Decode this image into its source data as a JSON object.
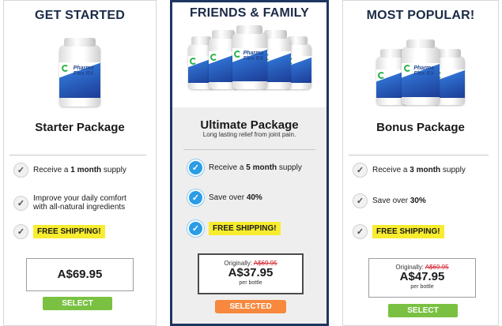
{
  "packages": [
    {
      "ribbon": "GET STARTED",
      "name": "Starter Package",
      "subtitle": "",
      "features": [
        {
          "pre": "Receive a ",
          "bold": "1 month",
          "post": " supply"
        },
        {
          "line1": "Improve your daily comfort",
          "line2": "with all-natural ingredients"
        }
      ],
      "shipping": "FREE SHIPPING!",
      "original_label": "",
      "original_price": "",
      "price": "A$69.95",
      "per_unit": "",
      "button": "SELECT"
    },
    {
      "ribbon": "FRIENDS & FAMILY",
      "name": "Ultimate Package",
      "subtitle": "Long lasting relief from joint pain.",
      "features": [
        {
          "pre": "Receive a ",
          "bold": "5 month",
          "post": " supply"
        },
        {
          "pre": "Save over ",
          "bold": "40%",
          "post": ""
        }
      ],
      "shipping": "FREE SHIPPING!",
      "original_label": "Originally: ",
      "original_price": "A$69.95",
      "price": "A$37.95",
      "per_unit": "per bottle",
      "button": "SELECTED"
    },
    {
      "ribbon": "MOST POPULAR!",
      "name": "Bonus Package",
      "subtitle": "",
      "features": [
        {
          "pre": "Receive a ",
          "bold": "3 month",
          "post": " supply"
        },
        {
          "pre": "Save over ",
          "bold": "30%",
          "post": ""
        }
      ],
      "shipping": "FREE SHIPPING!",
      "original_label": "Originally: ",
      "original_price": "A$69.95",
      "price": "A$47.95",
      "per_unit": "per bottle",
      "button": "SELECT"
    }
  ],
  "product_label": "Pharma Flex RX",
  "icons": {
    "check": "checkmark-icon",
    "bottle": "product-bottle-image"
  },
  "colors": {
    "title_navy": "#1b2b48",
    "featured_border": "#1e3560",
    "select_green": "#7ac142",
    "selected_orange": "#f7883d",
    "shipping_yellow": "#f7ec2e",
    "check_blue": "#2a9de6",
    "strike_red": "#d0202a"
  }
}
